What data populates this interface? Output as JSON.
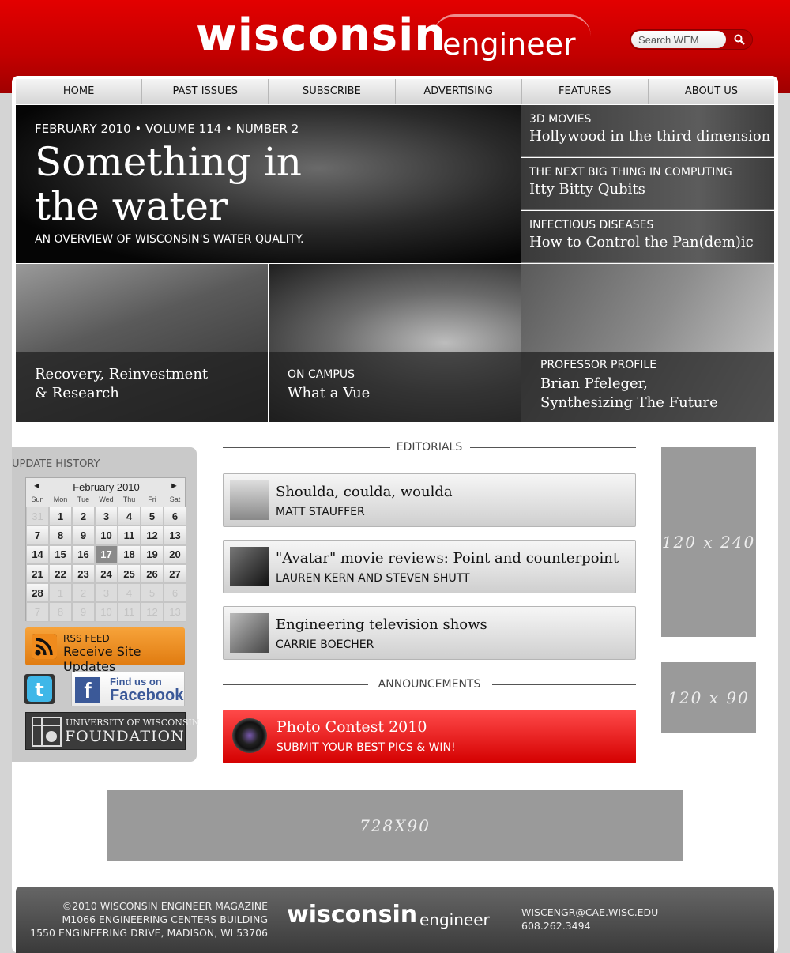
{
  "header": {
    "logo_main": "wisconsin",
    "logo_sub": "engineer",
    "search_placeholder": "Search WEM"
  },
  "nav": [
    "HOME",
    "PAST ISSUES",
    "SUBSCRIBE",
    "ADVERTISING",
    "FEATURES",
    "ABOUT US"
  ],
  "hero": {
    "meta": "FEBRUARY 2010  •  VOLUME 114  •  NUMBER 2",
    "title": "Something in the water",
    "subtitle": "AN OVERVIEW OF WISCONSIN'S WATER QUALITY."
  },
  "side_stories": [
    {
      "kicker": "3D MOVIES",
      "title": "Hollywood in the third dimension"
    },
    {
      "kicker": "THE NEXT BIG THING IN COMPUTING",
      "title": "Itty Bitty Qubits"
    },
    {
      "kicker": "INFECTIOUS DISEASES",
      "title": "How to Control the Pan(dem)ic"
    }
  ],
  "photo_stories": [
    {
      "kicker": "",
      "title_line1": "Recovery, Reinvestment",
      "title_line2": "& Research"
    },
    {
      "kicker": "ON CAMPUS",
      "title_line1": "What a Vue",
      "title_line2": ""
    },
    {
      "kicker": "PROFESSOR PROFILE",
      "title_line1": "Brian Pfeleger,",
      "title_line2": "Synthesizing The Future"
    }
  ],
  "sidebar": {
    "title": "UPDATE HISTORY",
    "calendar": {
      "month": "February 2010",
      "prev": "◄",
      "next": "►",
      "dows": [
        "Sun",
        "Mon",
        "Tue",
        "Wed",
        "Thu",
        "Fri",
        "Sat"
      ],
      "cells": [
        "31",
        "1",
        "2",
        "3",
        "4",
        "5",
        "6",
        "7",
        "8",
        "9",
        "10",
        "11",
        "12",
        "13",
        "14",
        "15",
        "16",
        "17",
        "18",
        "19",
        "20",
        "21",
        "22",
        "23",
        "24",
        "25",
        "26",
        "27",
        "28",
        "1",
        "2",
        "3",
        "4",
        "5",
        "6",
        "7",
        "8",
        "9",
        "10",
        "11",
        "12",
        "13"
      ],
      "today": "17"
    },
    "rss_small": "RSS FEED",
    "rss_big": "Receive Site Updates",
    "fb_small": "Find us on",
    "fb_big": "Facebook",
    "uwf_line1": "UNIVERSITY OF WISCONSIN",
    "uwf_line2": "FOUNDATION"
  },
  "editorials_label": "EDITORIALS",
  "editorials": [
    {
      "title": "Shoulda, coulda, woulda",
      "author": "MATT STAUFFER"
    },
    {
      "title": "\"Avatar\" movie reviews: Point and counterpoint",
      "author": "LAUREN KERN AND STEVEN SHUTT"
    },
    {
      "title": "Engineering television shows",
      "author": "CARRIE BOECHER"
    }
  ],
  "announcements_label": "ANNOUNCEMENTS",
  "announcement": {
    "title": "Photo Contest 2010",
    "subtitle": "SUBMIT YOUR BEST PICS & WIN!"
  },
  "ads": {
    "tall": "120 x 240",
    "small": "120 x 90",
    "banner": "728X90"
  },
  "footer": {
    "addr1": "©2010 WISCONSIN ENGINEER MAGAZINE",
    "addr2": "M1066 ENGINEERING CENTERS BUILDING",
    "addr3": "1550 ENGINEERING DRIVE, MADISON, WI 53706",
    "logo_main": "wisconsin",
    "logo_sub": "engineer",
    "email": "WISCENGR@CAE.WISC.EDU",
    "phone": "608.262.3494"
  }
}
